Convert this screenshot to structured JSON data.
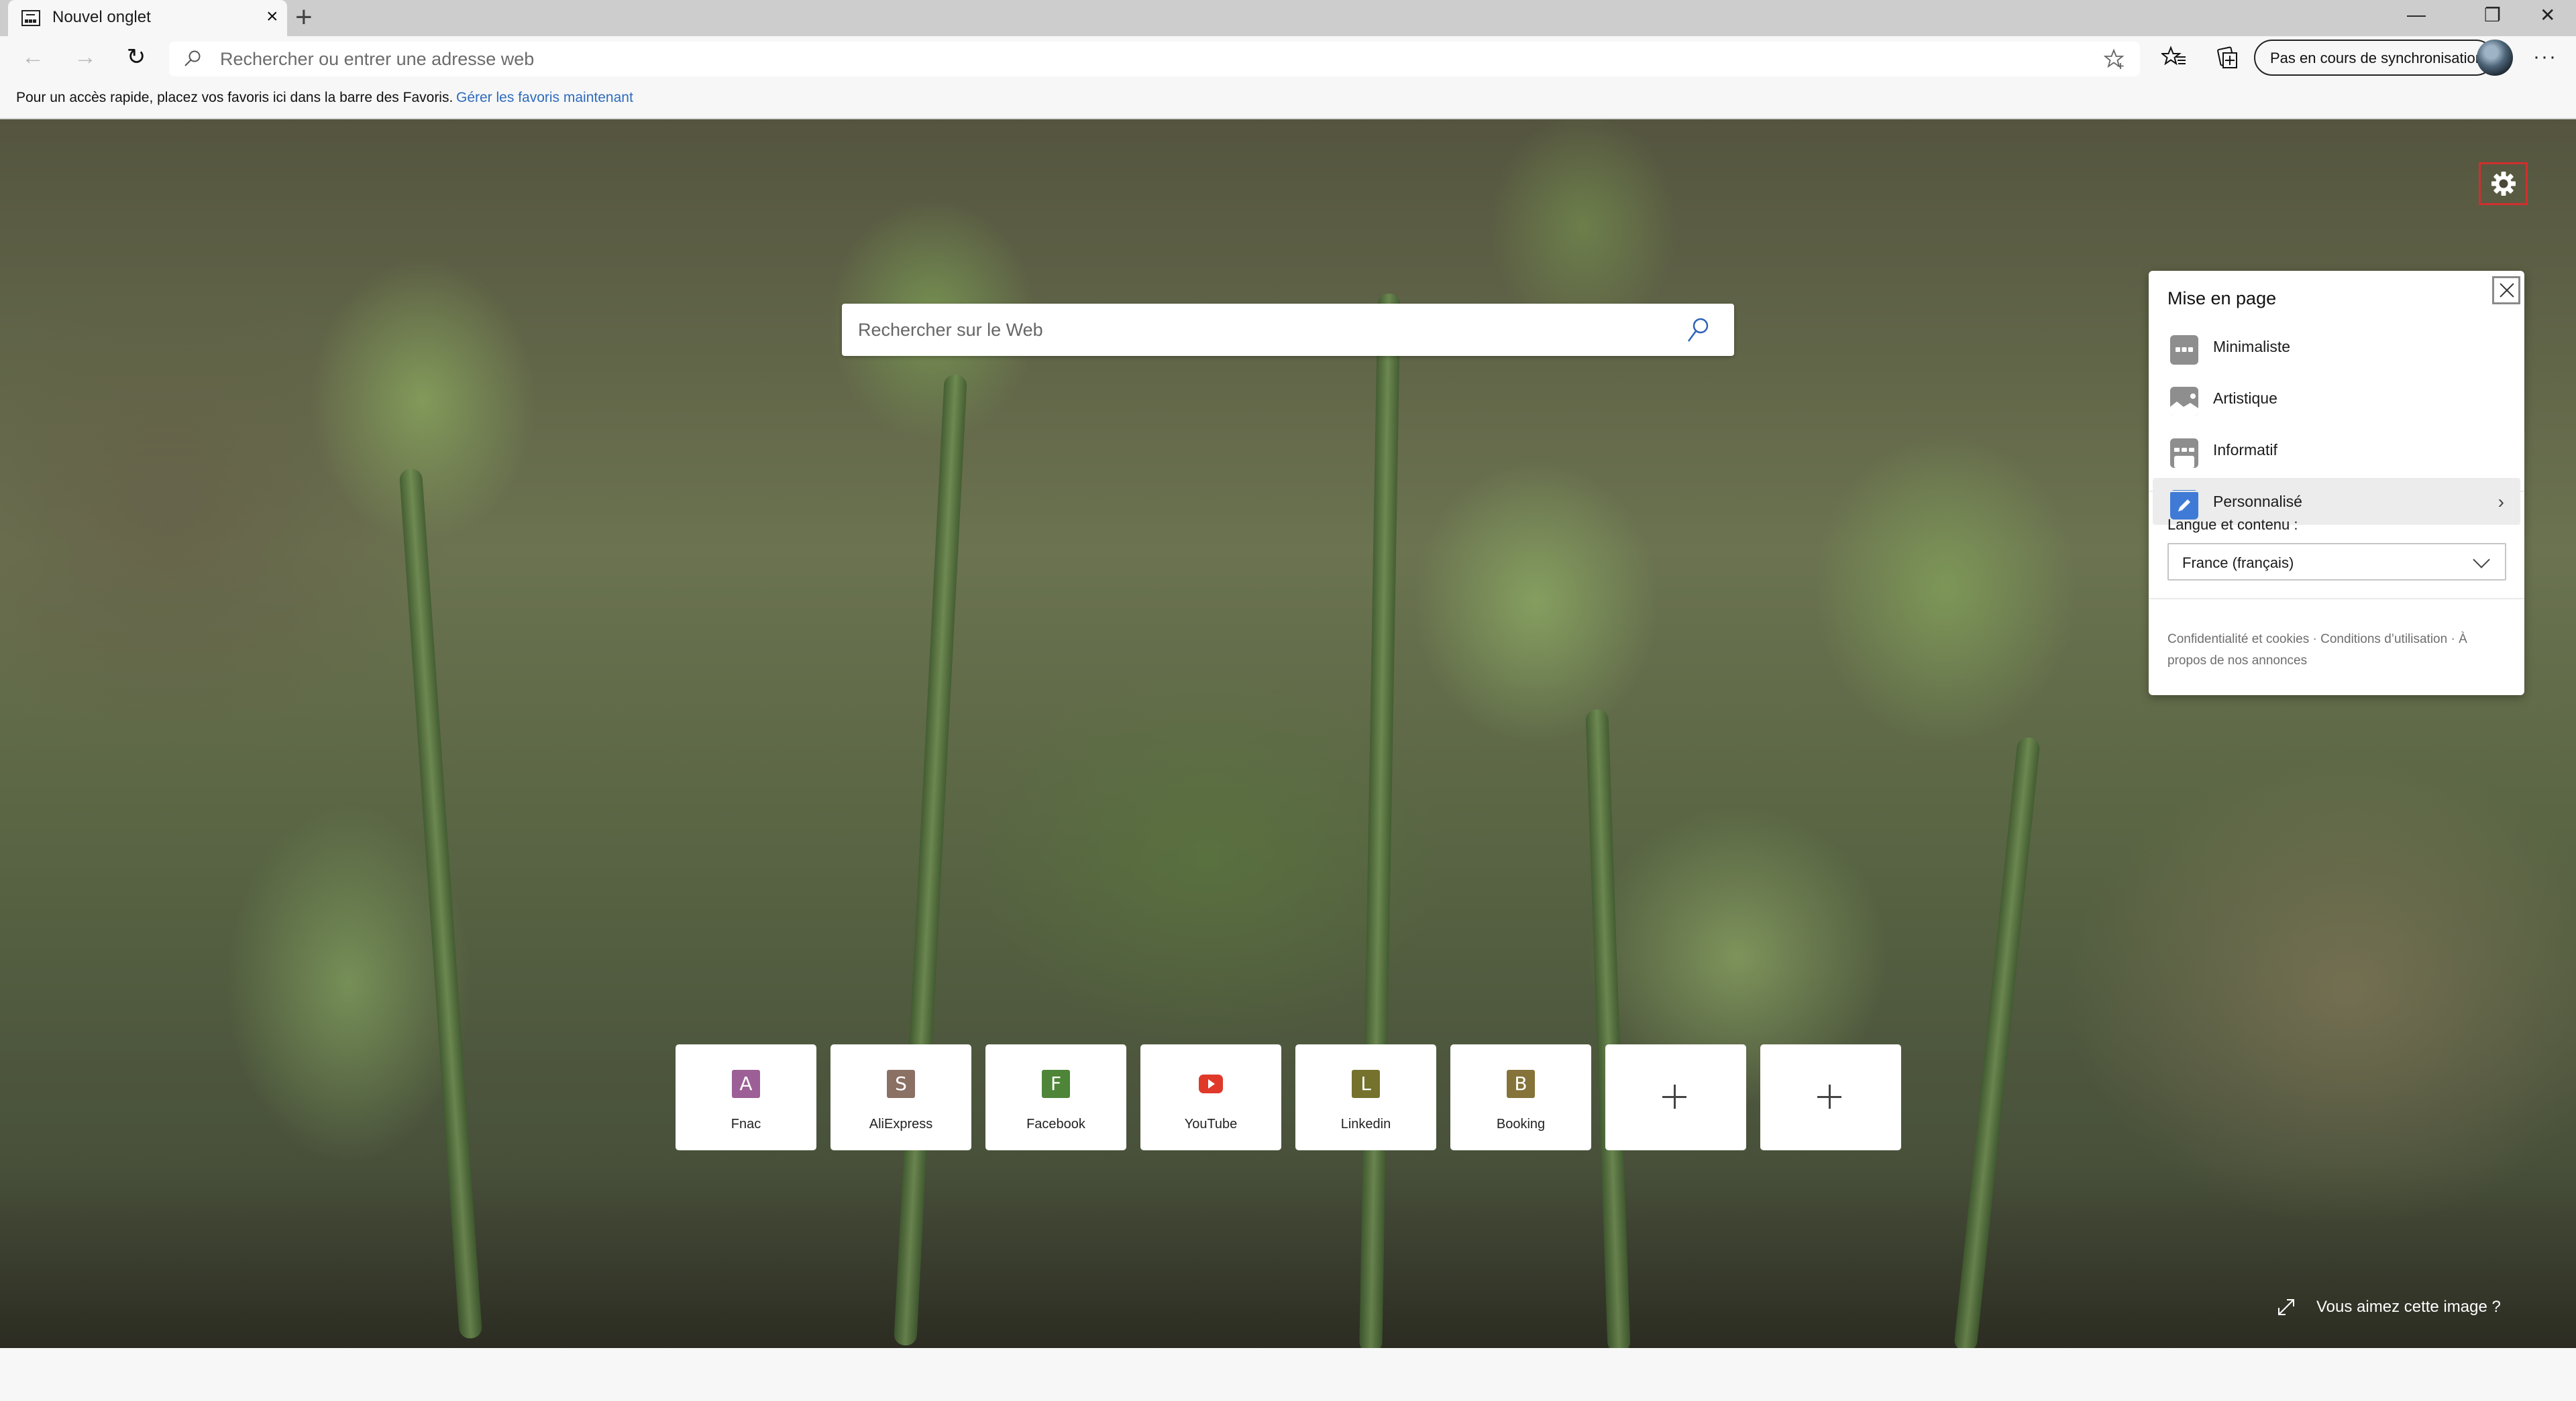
{
  "browser": {
    "tab": {
      "title": "Nouvel onglet",
      "close_label": "×"
    },
    "new_tab_label": "+",
    "window_controls": {
      "minimize": "—",
      "restore": "❐",
      "close": "✕"
    },
    "toolbar": {
      "back_label": "←",
      "forward_label": "→",
      "reload_label": "↻",
      "address_placeholder": "Rechercher ou entrer une adresse web",
      "address_value": "",
      "sync_label": "Pas en cours de synchronisation",
      "more_label": "···"
    },
    "favorites_bar": {
      "message": "Pour un accès rapide, placez vos favoris ici dans la barre des Favoris.",
      "link": "Gérer les favoris maintenant"
    }
  },
  "newtab": {
    "search_placeholder": "Rechercher sur le Web",
    "search_value": "",
    "top_sites": [
      {
        "name": "Fnac",
        "letter": "A",
        "color": "#9c5f96",
        "type": "letter"
      },
      {
        "name": "AliExpress",
        "letter": "S",
        "color": "#8b7064",
        "type": "letter"
      },
      {
        "name": "Facebook",
        "letter": "F",
        "color": "#4e8538",
        "type": "letter"
      },
      {
        "name": "YouTube",
        "letter": "",
        "color": "#e0392a",
        "type": "youtube"
      },
      {
        "name": "Linkedin",
        "letter": "L",
        "color": "#74722c",
        "type": "letter"
      },
      {
        "name": "Booking",
        "letter": "B",
        "color": "#857339",
        "type": "letter"
      },
      {
        "name": "",
        "letter": "",
        "color": "",
        "type": "add"
      },
      {
        "name": "",
        "letter": "",
        "color": "",
        "type": "add"
      }
    ],
    "like_image_label": "Vous aimez cette image ?"
  },
  "settings_panel": {
    "title": "Mise en page",
    "layouts": [
      {
        "label": "Minimaliste",
        "icon": "minimal-layout-icon",
        "selected": false
      },
      {
        "label": "Artistique",
        "icon": "artistic-layout-icon",
        "selected": false
      },
      {
        "label": "Informatif",
        "icon": "informational-layout-icon",
        "selected": false
      },
      {
        "label": "Personnalisé",
        "icon": "custom-layout-icon",
        "selected": true,
        "chevron": "›"
      }
    ],
    "language_label": "Langue et contenu :",
    "language_value": "France (français)",
    "footer_links": [
      "Confidentialité et cookies",
      "Conditions d’utilisation",
      "À propos de nos annonces"
    ],
    "footer_sep": " · ",
    "accent_color": "#3f7bd6",
    "highlight_color": "#d12f2f"
  }
}
